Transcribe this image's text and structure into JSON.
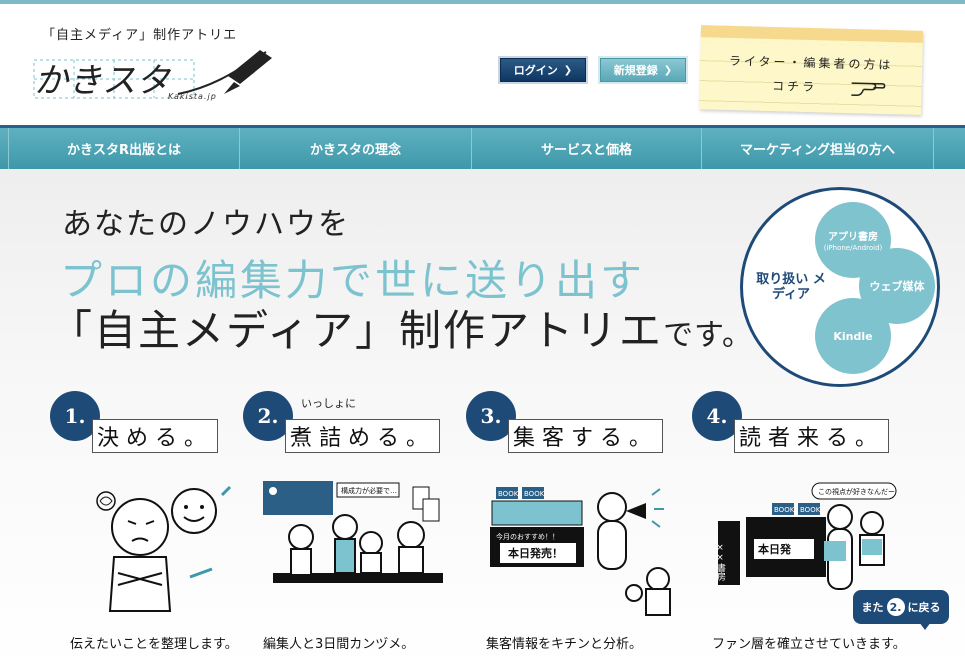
{
  "header": {
    "tagline": "「自主メディア」制作アトリエ",
    "logo_text": "かきスタ",
    "logo_url": "Kakista.jp",
    "login_label": "ログイン",
    "register_label": "新規登録",
    "writer_note_line1": "ライター・編集者の方は",
    "writer_note_line2": "コチラ"
  },
  "nav": {
    "items": [
      {
        "label": "かきスタR出版とは"
      },
      {
        "label": "かきスタの理念"
      },
      {
        "label": "サービスと価格"
      },
      {
        "label": "マーケティング担当の方へ"
      }
    ]
  },
  "hero": {
    "line1": "あなたのノウハウを",
    "line2": "プロの編集力で世に送り出す",
    "line3": "「自主メディア」制作アトリエ",
    "line3_suffix": "です。"
  },
  "media": {
    "title": "取り扱い メディア",
    "app": "アプリ書房",
    "app_sub": "(iPhone/Android)",
    "web": "ウェブ媒体",
    "kindle": "Kindle"
  },
  "steps": [
    {
      "num": "1.",
      "verb": "決める。",
      "note": "",
      "caption": "伝えたいことを整理します。"
    },
    {
      "num": "2.",
      "verb": "煮詰める。",
      "note": "いっしょに",
      "caption": "編集人と3日間カンヅメ。",
      "illus_text": "構成力が必要で…"
    },
    {
      "num": "3.",
      "verb": "集客する。",
      "note": "",
      "caption": "集客情報をキチンと分析。",
      "illus_book": "BOOK",
      "illus_rec": "今月のおすすめ！！",
      "illus_sale": "本日発売！"
    },
    {
      "num": "4.",
      "verb": "読者来る。",
      "note": "",
      "caption": "ファン層を確立させていきます。",
      "illus_text": "この視点が好きなんだー",
      "illus_shop": "××書房",
      "illus_book": "BOOK",
      "illus_sale": "本日発"
    }
  ],
  "back_button": {
    "pre": "また",
    "num": "2.",
    "post": "に戻る"
  },
  "colors": {
    "navy": "#1e4a78",
    "teal": "#7cc3cf",
    "nav": "#4ba2b3"
  }
}
